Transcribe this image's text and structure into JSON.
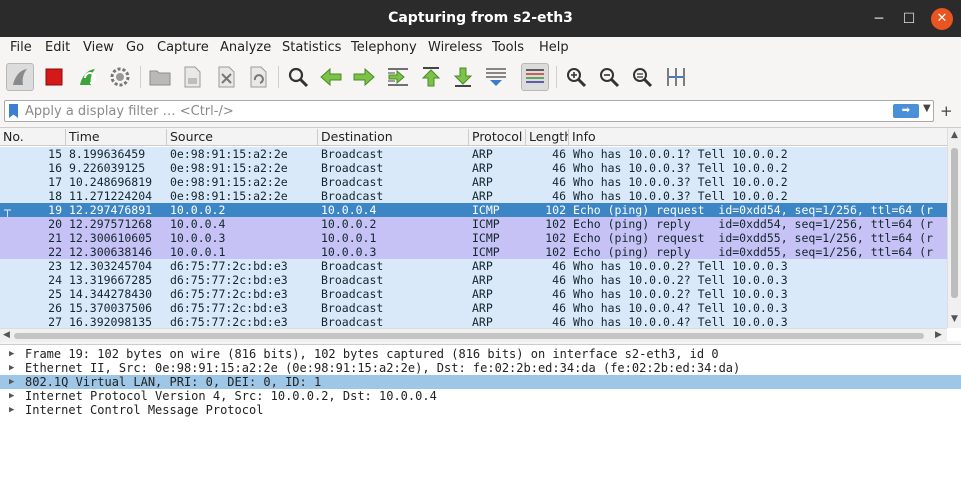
{
  "window": {
    "title": "Capturing from s2-eth3",
    "minimize": "─",
    "maximize": "☐",
    "close": "✕"
  },
  "menu": [
    "File",
    "Edit",
    "View",
    "Go",
    "Capture",
    "Analyze",
    "Statistics",
    "Telephony",
    "Wireless",
    "Tools",
    "Help"
  ],
  "toolbar_icons": [
    "shark-fin-start-icon",
    "stop-capture-icon",
    "restart-capture-icon",
    "capture-options-icon",
    "open-file-icon",
    "save-file-icon",
    "close-file-icon",
    "reload-file-icon",
    "find-packet-icon",
    "go-back-icon",
    "go-forward-icon",
    "go-to-packet-icon",
    "go-first-packet-icon",
    "go-last-packet-icon",
    "autoscroll-icon",
    "colorize-icon",
    "zoom-in-icon",
    "zoom-out-icon",
    "normal-size-icon",
    "resize-columns-icon"
  ],
  "filter": {
    "placeholder": "Apply a display filter … <Ctrl-/>",
    "apply_icon": "arrow-right-icon",
    "plus": "+"
  },
  "columns": [
    "No.",
    "Time",
    "Source",
    "Destination",
    "Protocol",
    "Length",
    "Info"
  ],
  "packets": [
    {
      "no": "15",
      "time": "8.199636459",
      "src": "0e:98:91:15:a2:2e",
      "dst": "Broadcast",
      "proto": "ARP",
      "len": "46",
      "info": "Who has 10.0.0.1? Tell 10.0.0.2",
      "kind": "arp"
    },
    {
      "no": "16",
      "time": "9.226039125",
      "src": "0e:98:91:15:a2:2e",
      "dst": "Broadcast",
      "proto": "ARP",
      "len": "46",
      "info": "Who has 10.0.0.3? Tell 10.0.0.2",
      "kind": "arp"
    },
    {
      "no": "17",
      "time": "10.248696819",
      "src": "0e:98:91:15:a2:2e",
      "dst": "Broadcast",
      "proto": "ARP",
      "len": "46",
      "info": "Who has 10.0.0.3? Tell 10.0.0.2",
      "kind": "arp"
    },
    {
      "no": "18",
      "time": "11.271224204",
      "src": "0e:98:91:15:a2:2e",
      "dst": "Broadcast",
      "proto": "ARP",
      "len": "46",
      "info": "Who has 10.0.0.3? Tell 10.0.0.2",
      "kind": "arp"
    },
    {
      "no": "19",
      "time": "12.297476891",
      "src": "10.0.0.2",
      "dst": "10.0.0.4",
      "proto": "ICMP",
      "len": "102",
      "info": "Echo (ping) request  id=0xdd54, seq=1/256, ttl=64 (r",
      "kind": "selected"
    },
    {
      "no": "20",
      "time": "12.297571268",
      "src": "10.0.0.4",
      "dst": "10.0.0.2",
      "proto": "ICMP",
      "len": "102",
      "info": "Echo (ping) reply    id=0xdd54, seq=1/256, ttl=64 (r",
      "kind": "icmp"
    },
    {
      "no": "21",
      "time": "12.300610605",
      "src": "10.0.0.3",
      "dst": "10.0.0.1",
      "proto": "ICMP",
      "len": "102",
      "info": "Echo (ping) request  id=0xdd55, seq=1/256, ttl=64 (r",
      "kind": "icmp"
    },
    {
      "no": "22",
      "time": "12.300638146",
      "src": "10.0.0.1",
      "dst": "10.0.0.3",
      "proto": "ICMP",
      "len": "102",
      "info": "Echo (ping) reply    id=0xdd55, seq=1/256, ttl=64 (r",
      "kind": "icmp"
    },
    {
      "no": "23",
      "time": "12.303245704",
      "src": "d6:75:77:2c:bd:e3",
      "dst": "Broadcast",
      "proto": "ARP",
      "len": "46",
      "info": "Who has 10.0.0.2? Tell 10.0.0.3",
      "kind": "arp"
    },
    {
      "no": "24",
      "time": "13.319667285",
      "src": "d6:75:77:2c:bd:e3",
      "dst": "Broadcast",
      "proto": "ARP",
      "len": "46",
      "info": "Who has 10.0.0.2? Tell 10.0.0.3",
      "kind": "arp"
    },
    {
      "no": "25",
      "time": "14.344278430",
      "src": "d6:75:77:2c:bd:e3",
      "dst": "Broadcast",
      "proto": "ARP",
      "len": "46",
      "info": "Who has 10.0.0.2? Tell 10.0.0.3",
      "kind": "arp"
    },
    {
      "no": "26",
      "time": "15.370037506",
      "src": "d6:75:77:2c:bd:e3",
      "dst": "Broadcast",
      "proto": "ARP",
      "len": "46",
      "info": "Who has 10.0.0.4? Tell 10.0.0.3",
      "kind": "arp"
    },
    {
      "no": "27",
      "time": "16.392098135",
      "src": "d6:75:77:2c:bd:e3",
      "dst": "Broadcast",
      "proto": "ARP",
      "len": "46",
      "info": "Who has 10.0.0.4? Tell 10.0.0.3",
      "kind": "arp"
    }
  ],
  "row_colors": {
    "arp": "#d9e9f9",
    "icmp": "#c7c2f5",
    "selected": "#3d86c6",
    "selected_text": "#ffffff",
    "text": "#12272e"
  },
  "details": [
    {
      "text": "Frame 19: 102 bytes on wire (816 bits), 102 bytes captured (816 bits) on interface s2-eth3, id 0",
      "selected": false
    },
    {
      "text": "Ethernet II, Src: 0e:98:91:15:a2:2e (0e:98:91:15:a2:2e), Dst: fe:02:2b:ed:34:da (fe:02:2b:ed:34:da)",
      "selected": false
    },
    {
      "text": "802.1Q Virtual LAN, PRI: 0, DEI: 0, ID: 1",
      "selected": true
    },
    {
      "text": "Internet Protocol Version 4, Src: 10.0.0.2, Dst: 10.0.0.4",
      "selected": false
    },
    {
      "text": "Internet Control Message Protocol",
      "selected": false
    }
  ]
}
